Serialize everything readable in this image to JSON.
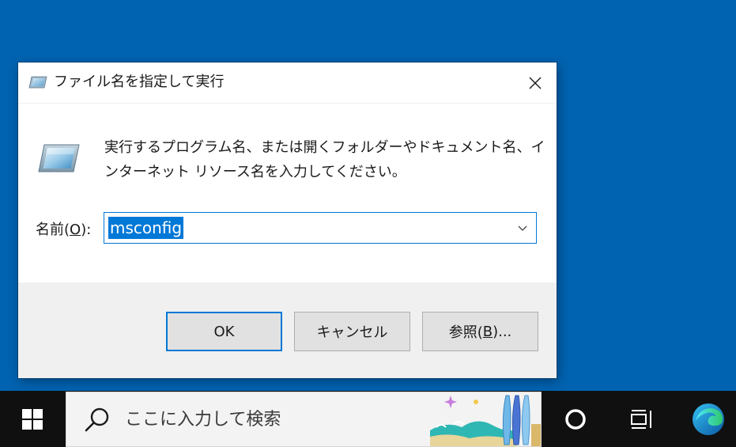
{
  "dialog": {
    "title": "ファイル名を指定して実行",
    "description": "実行するプログラム名、または開くフォルダーやドキュメント名、インターネット リソース名を入力してください。",
    "name_label_prefix": "名前(",
    "name_label_access": "O",
    "name_label_suffix": "):",
    "input_value": "msconfig",
    "buttons": {
      "ok": "OK",
      "cancel": "キャンセル",
      "browse_prefix": "参照(",
      "browse_access": "B",
      "browse_suffix": ")..."
    }
  },
  "taskbar": {
    "search_placeholder": "ここに入力して検索",
    "icons": [
      "windows-logo-icon",
      "search-icon",
      "cortana-icon",
      "task-view-icon",
      "edge-icon"
    ]
  },
  "colors": {
    "desktop": "#0063b1",
    "accent": "#0078d7",
    "taskbar": "#101010",
    "dialog_footer": "#f0f0f0"
  }
}
